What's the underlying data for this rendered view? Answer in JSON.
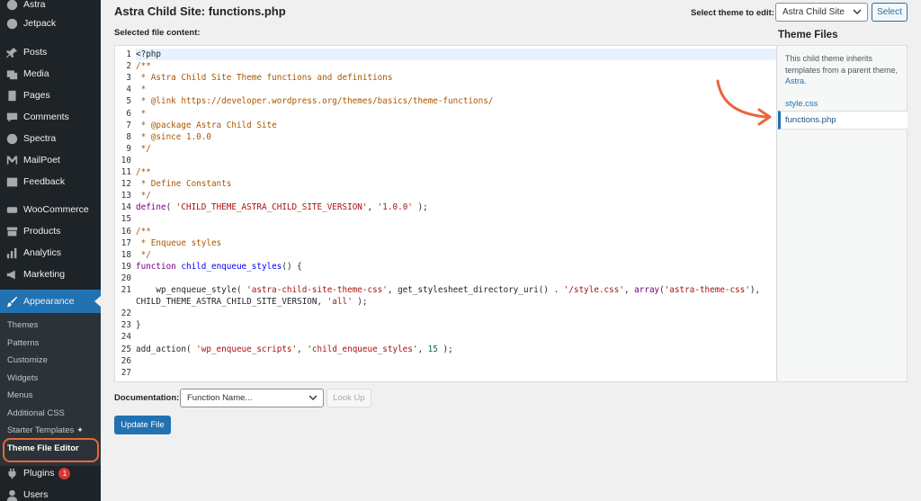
{
  "colors": {
    "sidebar_bg": "#1d2327",
    "accent": "#2271b1",
    "annotation": "#e8663c",
    "badge": "#d63638"
  },
  "sidebar": {
    "top_items": [
      {
        "label": "Astra",
        "icon": "astra-logo-icon"
      },
      {
        "label": "Jetpack",
        "icon": "jetpack-icon"
      },
      {
        "label": "Posts",
        "icon": "pin-icon"
      },
      {
        "label": "Media",
        "icon": "media-icon"
      },
      {
        "label": "Pages",
        "icon": "pages-icon"
      },
      {
        "label": "Comments",
        "icon": "comment-icon"
      },
      {
        "label": "Spectra",
        "icon": "spectra-icon"
      },
      {
        "label": "MailPoet",
        "icon": "mailpoet-icon"
      },
      {
        "label": "Feedback",
        "icon": "feedback-icon"
      },
      {
        "label": "WooCommerce",
        "icon": "woocommerce-icon"
      },
      {
        "label": "Products",
        "icon": "archive-icon"
      },
      {
        "label": "Analytics",
        "icon": "chart-bar-icon"
      },
      {
        "label": "Marketing",
        "icon": "megaphone-icon"
      },
      {
        "label": "Appearance",
        "icon": "paintbrush-icon"
      }
    ],
    "submenu": [
      {
        "label": "Themes"
      },
      {
        "label": "Patterns"
      },
      {
        "label": "Customize"
      },
      {
        "label": "Widgets"
      },
      {
        "label": "Menus"
      },
      {
        "label": "Additional CSS"
      },
      {
        "label": "Starter Templates"
      },
      {
        "label": "Theme File Editor"
      }
    ],
    "bottom_items": [
      {
        "label": "Plugins",
        "icon": "plugins-icon",
        "badge": "1"
      },
      {
        "label": "Users",
        "icon": "users-icon"
      }
    ]
  },
  "header": {
    "title": "Astra Child Site: functions.php",
    "selected_label": "Selected file content:",
    "select_theme_label": "Select theme to edit:",
    "theme_selected": "Astra Child Site",
    "select_button": "Select"
  },
  "editor": {
    "line_numbers": [
      "1",
      "2",
      "3",
      "4",
      "5",
      "6",
      "7",
      "8",
      "9",
      "10",
      "11",
      "12",
      "13",
      "14",
      "15",
      "16",
      "17",
      "18",
      "19",
      "20",
      "21",
      "",
      "22",
      "23",
      "24",
      "25",
      "26",
      "27"
    ],
    "lines": [
      "<?php",
      "/**",
      " * Astra Child Site Theme functions and definitions",
      " *",
      " * @link https://developer.wordpress.org/themes/basics/theme-functions/",
      " *",
      " * @package Astra Child Site",
      " * @since 1.0.0",
      " */",
      "",
      "/**",
      " * Define Constants",
      " */",
      "define( 'CHILD_THEME_ASTRA_CHILD_SITE_VERSION', '1.0.0' );",
      "",
      "/**",
      " * Enqueue styles",
      " */",
      "function child_enqueue_styles() {",
      "",
      "    wp_enqueue_style( 'astra-child-site-theme-css', get_stylesheet_directory_uri() . '/style.css', array('astra-theme-css'),",
      "CHILD_THEME_ASTRA_CHILD_SITE_VERSION, 'all' );",
      "",
      "}",
      "",
      "add_action( 'wp_enqueue_scripts', 'child_enqueue_styles', 15 );",
      "",
      ""
    ]
  },
  "theme_files": {
    "heading": "Theme Files",
    "note_prefix": "This child theme inherits templates from a parent theme,",
    "note_link": "Astra",
    "note_suffix": ".",
    "files": [
      "style.css",
      "functions.php"
    ]
  },
  "bottom": {
    "doc_label": "Documentation:",
    "doc_placeholder": "Function Name...",
    "lookup_button": "Look Up",
    "update_button": "Update File"
  }
}
